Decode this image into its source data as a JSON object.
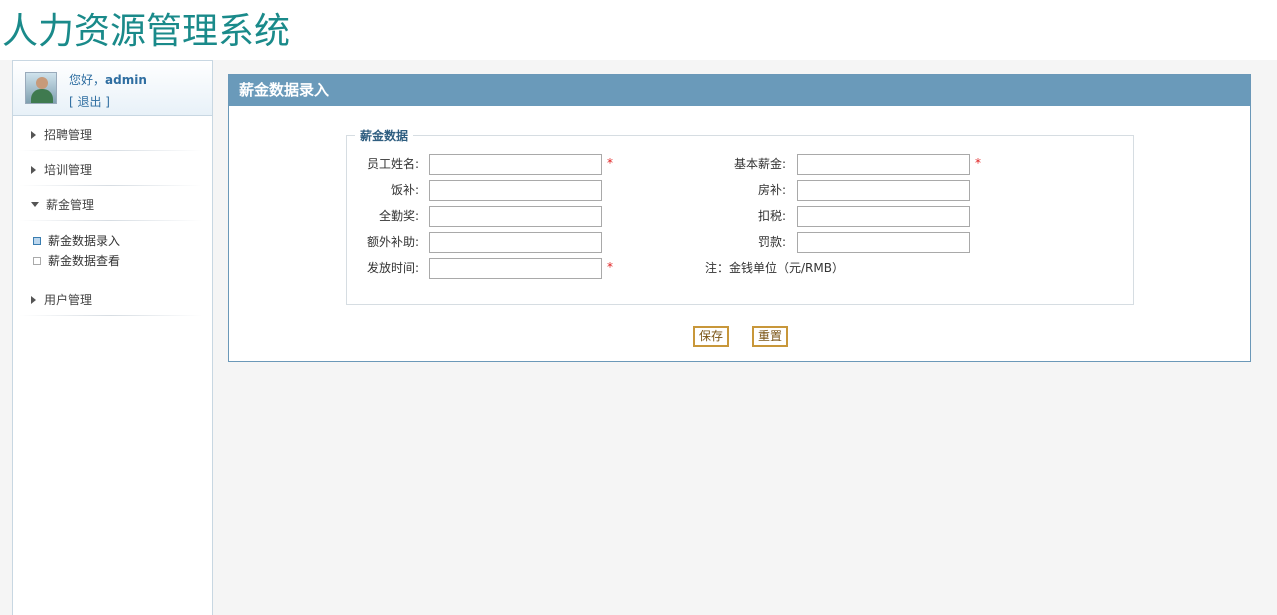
{
  "app": {
    "title": "人力资源管理系统"
  },
  "user": {
    "greeting": "您好，",
    "name": "admin",
    "logout": "[ 退出 ]"
  },
  "sidebar": {
    "items": [
      {
        "label": "招聘管理",
        "expanded": false
      },
      {
        "label": "培训管理",
        "expanded": false
      },
      {
        "label": "薪金管理",
        "expanded": true,
        "children": [
          {
            "label": "薪金数据录入",
            "active": true
          },
          {
            "label": "薪金数据查看",
            "active": false
          }
        ]
      },
      {
        "label": "用户管理",
        "expanded": false
      }
    ]
  },
  "panel": {
    "title": "薪金数据录入",
    "legend": "薪金数据",
    "fields": {
      "employee_name": {
        "label": "员工姓名:",
        "value": "",
        "required": true
      },
      "base_salary": {
        "label": "基本薪金:",
        "value": "",
        "required": true
      },
      "meal_allowance": {
        "label": "饭补:",
        "value": ""
      },
      "housing_allowance": {
        "label": "房补:",
        "value": ""
      },
      "attendance_bonus": {
        "label": "全勤奖:",
        "value": ""
      },
      "tax_deduction": {
        "label": "扣税:",
        "value": ""
      },
      "extra_allowance": {
        "label": "额外补助:",
        "value": ""
      },
      "fine": {
        "label": "罚款:",
        "value": ""
      },
      "payment_time": {
        "label": "发放时间:",
        "value": "",
        "required": true
      }
    },
    "required_mark": "*",
    "note": "注：金钱单位（元/RMB）",
    "save_label": "保存",
    "reset_label": "重置"
  },
  "colors": {
    "title": "#1a8a8a",
    "panel_header": "#6a9aba",
    "required": "#e02020",
    "button_border": "#c8973a"
  }
}
